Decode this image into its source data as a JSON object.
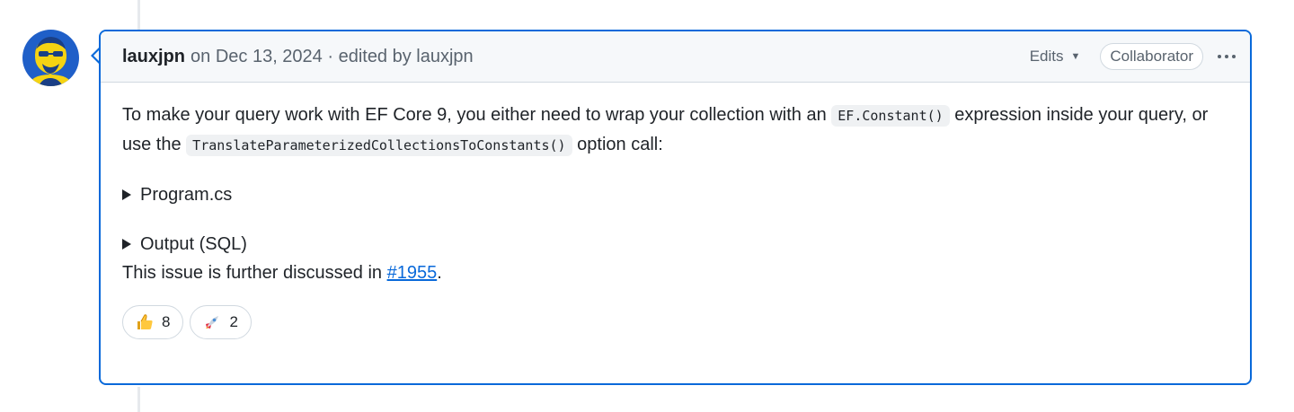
{
  "comment": {
    "author": "lauxjpn",
    "meta": "on Dec 13, 2024 · edited by lauxjpn",
    "edits_label": "Edits",
    "role_badge": "Collaborator",
    "body": {
      "p1_part1": "To make your query work with EF Core 9, you either need to wrap your collection with an",
      "p1_code1": "EF.Constant()",
      "p1_part2": "expression inside your query, or use the",
      "p1_code2": "TranslateParameterizedCollectionsToConstants()",
      "p1_part3": "option call:",
      "details": [
        {
          "summary": "Program.cs"
        },
        {
          "summary": "Output (SQL)"
        }
      ],
      "issue_text": "This issue is further discussed in",
      "issue_link": "#1955",
      "issue_end": "."
    },
    "reactions": [
      {
        "icon": "thumbs-up-icon",
        "count": "8"
      },
      {
        "icon": "rocket-icon",
        "count": "2"
      }
    ]
  },
  "colors": {
    "accent": "#0969da",
    "header_bg": "#f6f8fa",
    "avatar_bg": "#1f5fc8",
    "avatar_fg": "#f5d312"
  }
}
